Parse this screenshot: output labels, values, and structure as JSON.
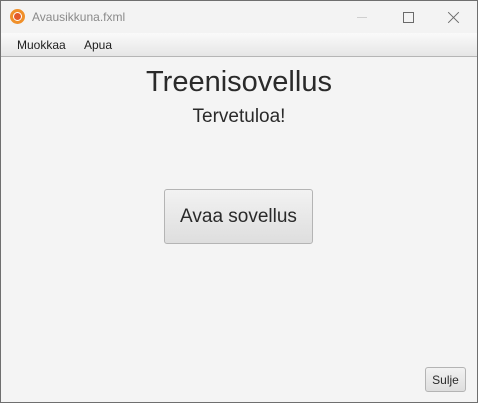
{
  "window": {
    "title": "Avausikkuna.fxml"
  },
  "menubar": {
    "items": [
      {
        "label": "Muokkaa"
      },
      {
        "label": "Apua"
      }
    ]
  },
  "main": {
    "heading": "Treenisovellus",
    "subheading": "Tervetuloa!",
    "open_button_label": "Avaa sovellus",
    "close_button_label": "Sulje"
  },
  "icons": {
    "app": "app-icon",
    "minimize": "minimize-icon",
    "maximize": "maximize-icon",
    "close": "close-icon"
  },
  "colors": {
    "app_icon": "#f0902a",
    "background": "#f4f4f4",
    "text": "#2a2a2a"
  }
}
